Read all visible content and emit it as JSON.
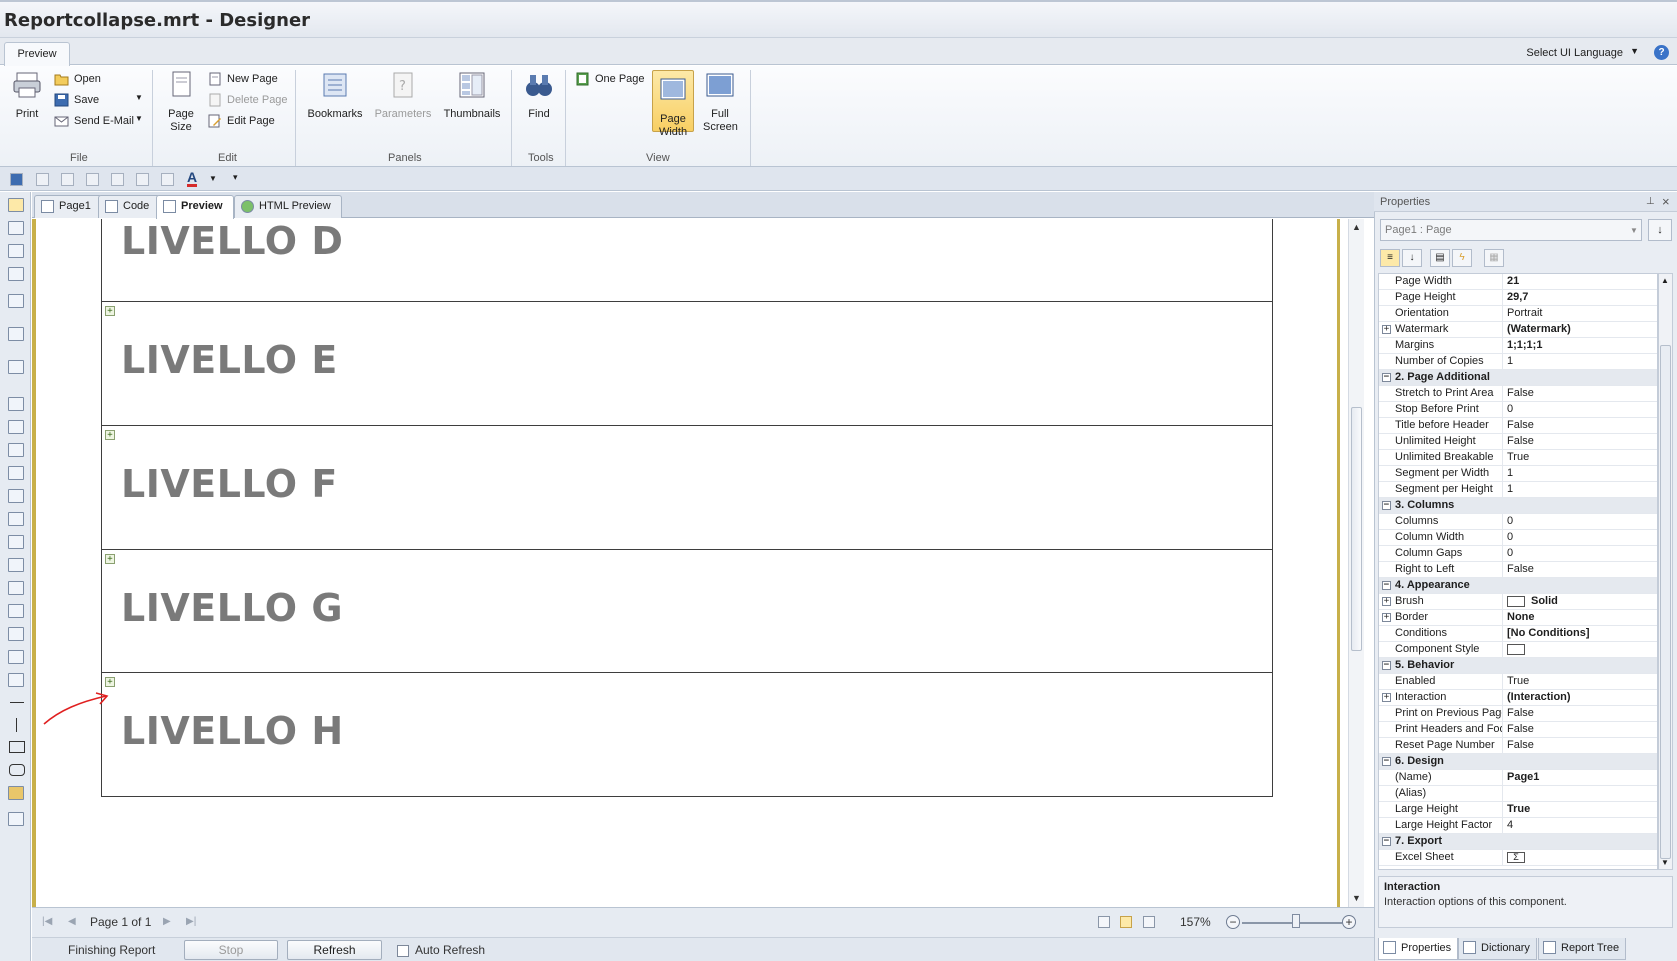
{
  "window": {
    "title": "Reportcollapse.mrt - Designer"
  },
  "ribbon": {
    "tab": "Preview",
    "ui_language": "Select UI Language",
    "file": {
      "label": "File",
      "print": "Print",
      "open": "Open",
      "save": "Save",
      "send_email": "Send E-Mail"
    },
    "edit": {
      "label": "Edit",
      "page_size": "Page Size",
      "new_page": "New Page",
      "delete_page": "Delete Page",
      "edit_page": "Edit Page"
    },
    "panels": {
      "label": "Panels",
      "bookmarks": "Bookmarks",
      "parameters": "Parameters",
      "thumbnails": "Thumbnails"
    },
    "tools": {
      "label": "Tools",
      "find": "Find"
    },
    "view": {
      "label": "View",
      "one_page": "One Page",
      "page_width": "Page Width",
      "full_screen": "Full Screen"
    }
  },
  "doc_tabs": [
    {
      "label": "Page1"
    },
    {
      "label": "Code"
    },
    {
      "label": "Preview",
      "active": true
    },
    {
      "label": "HTML Preview"
    }
  ],
  "bands": [
    {
      "label": "LIVELLO D"
    },
    {
      "label": "LIVELLO E"
    },
    {
      "label": "LIVELLO F"
    },
    {
      "label": "LIVELLO G"
    },
    {
      "label": "LIVELLO H"
    }
  ],
  "navigation": {
    "page_of": "Page 1 of 1",
    "zoom": "157%"
  },
  "status": {
    "text": "Finishing Report",
    "stop": "Stop",
    "refresh": "Refresh",
    "auto_refresh": "Auto Refresh"
  },
  "properties": {
    "header": "Properties",
    "object": "Page1 : Page",
    "rows": [
      {
        "key": "Page Width",
        "value": "21",
        "bold": true
      },
      {
        "key": "Page Height",
        "value": "29,7",
        "bold": true
      },
      {
        "key": "Orientation",
        "value": "Portrait"
      },
      {
        "key": "Watermark",
        "value": "(Watermark)",
        "bold": true,
        "expand": "+"
      },
      {
        "key": "Margins",
        "value": "1;1;1;1",
        "bold": true
      },
      {
        "key": "Number of Copies",
        "value": "1"
      },
      {
        "category": "2. Page  Additional"
      },
      {
        "key": "Stretch to Print Area",
        "value": "False"
      },
      {
        "key": "Stop Before Print",
        "value": "0"
      },
      {
        "key": "Title before Header",
        "value": "False"
      },
      {
        "key": "Unlimited Height",
        "value": "False"
      },
      {
        "key": "Unlimited Breakable",
        "value": "True"
      },
      {
        "key": "Segment per Width",
        "value": "1"
      },
      {
        "key": "Segment per Height",
        "value": "1"
      },
      {
        "category": "3. Columns"
      },
      {
        "key": "Columns",
        "value": "0"
      },
      {
        "key": "Column Width",
        "value": "0"
      },
      {
        "key": "Column Gaps",
        "value": "0"
      },
      {
        "key": "Right to Left",
        "value": "False"
      },
      {
        "category": "4. Appearance"
      },
      {
        "key": "Brush",
        "value": "Solid",
        "bold": true,
        "expand": "+",
        "swatch": true
      },
      {
        "key": "Border",
        "value": "None",
        "bold": true,
        "expand": "+"
      },
      {
        "key": "Conditions",
        "value": "[No Conditions]",
        "bold": true
      },
      {
        "key": "Component Style",
        "value": "",
        "swatch": true
      },
      {
        "category": "5. Behavior"
      },
      {
        "key": "Enabled",
        "value": "True"
      },
      {
        "key": "Interaction",
        "value": "(Interaction)",
        "bold": true,
        "expand": "+"
      },
      {
        "key": "Print on Previous Page",
        "value": "False"
      },
      {
        "key": "Print Headers and Footers",
        "value": "False"
      },
      {
        "key": "Reset Page Number",
        "value": "False"
      },
      {
        "category": "6. Design"
      },
      {
        "key": "(Name)",
        "value": "Page1",
        "bold": true
      },
      {
        "key": "(Alias)",
        "value": ""
      },
      {
        "key": "Large Height",
        "value": "True",
        "bold": true
      },
      {
        "key": "Large Height Factor",
        "value": "4"
      },
      {
        "category": "7. Export"
      },
      {
        "key": "Excel Sheet",
        "value": "Σ",
        "swatch": true
      }
    ],
    "description": {
      "title": "Interaction",
      "text": "Interaction options of this component."
    },
    "bottom_tabs": [
      "Properties",
      "Dictionary",
      "Report Tree"
    ]
  }
}
